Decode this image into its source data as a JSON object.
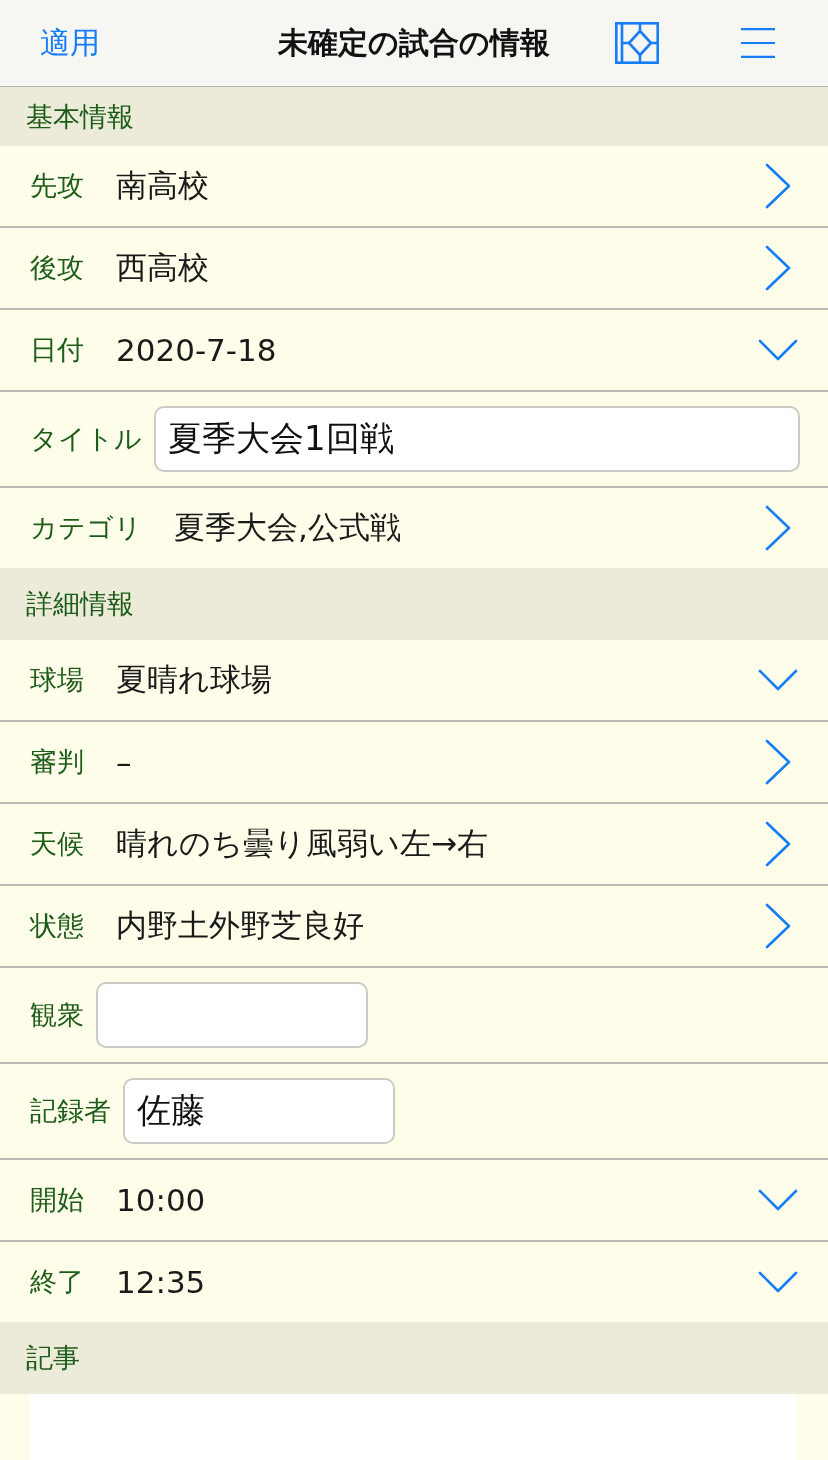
{
  "nav_bar": {
    "apply_button": "適用",
    "title": "未確定の試合の情報"
  },
  "sections": [
    {
      "title": "基本情報",
      "rows": [
        {
          "kind": "link",
          "label": "先攻",
          "value": "南高校"
        },
        {
          "kind": "link",
          "label": "後攻",
          "value": "西高校"
        },
        {
          "kind": "dropdown",
          "label": "日付",
          "value": "2020-7-18"
        },
        {
          "kind": "wide_field",
          "label": "タイトル",
          "value": "夏季大会1回戦"
        },
        {
          "kind": "link",
          "label": "カテゴリ",
          "value": "夏季大会,公式戦"
        }
      ]
    },
    {
      "title": "詳細情報",
      "rows": [
        {
          "kind": "dropdown",
          "label": "球場",
          "value": "夏晴れ球場"
        },
        {
          "kind": "link",
          "label": "審判",
          "value": "–"
        },
        {
          "kind": "link",
          "label": "天候",
          "value": "晴れのち曇り風弱い左→右"
        },
        {
          "kind": "link",
          "label": "状態",
          "value": "内野土外野芝良好"
        },
        {
          "kind": "short_field",
          "label": "観衆"
        },
        {
          "kind": "short_field",
          "label": "記録者",
          "value": "佐藤"
        },
        {
          "kind": "dropdown",
          "label": "開始",
          "value": "10:00"
        },
        {
          "kind": "dropdown",
          "label": "終了",
          "value": "12:35"
        }
      ]
    },
    {
      "title": "記事",
      "rows": [
        {
          "kind": "memo"
        }
      ]
    }
  ]
}
